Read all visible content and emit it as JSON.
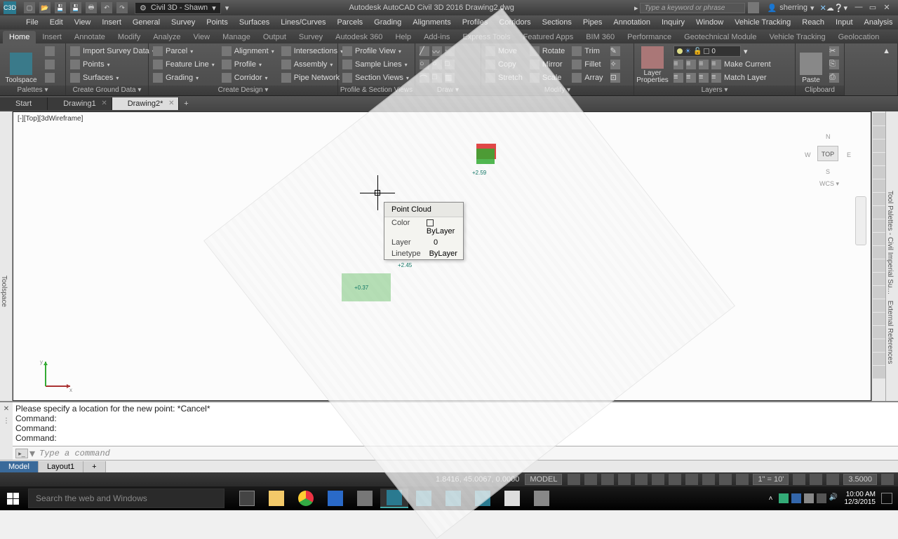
{
  "title": "Autodesk AutoCAD Civil 3D 2016   Drawing2.dwg",
  "workspace": "Civil 3D - Shawn",
  "search_placeholder": "Type a keyword or phrase",
  "user": "sherring",
  "menu": [
    "File",
    "Edit",
    "View",
    "Insert",
    "General",
    "Survey",
    "Points",
    "Surfaces",
    "Lines/Curves",
    "Parcels",
    "Grading",
    "Alignments",
    "Profiles",
    "Corridors",
    "Sections",
    "Pipes",
    "Annotation",
    "Inquiry",
    "Window",
    "Vehicle Tracking",
    "Reach",
    "Input",
    "Analysis"
  ],
  "ribbon_tabs": [
    "Home",
    "Insert",
    "Annotate",
    "Modify",
    "Analyze",
    "View",
    "Manage",
    "Output",
    "Survey",
    "Autodesk 360",
    "Help",
    "Add-ins",
    "Express Tools",
    "Featured Apps",
    "BIM 360",
    "Performance",
    "Geotechnical Module",
    "Vehicle Tracking",
    "Geolocation"
  ],
  "ribbon_active": "Home",
  "panel": {
    "palettes": {
      "title": "Palettes ▾",
      "big": "Toolspace"
    },
    "ground": {
      "title": "Create Ground Data ▾",
      "items": [
        "Import Survey Data",
        "Points",
        "Surfaces"
      ]
    },
    "design": {
      "title": "Create Design ▾",
      "col1": [
        "Parcel",
        "Feature Line",
        "Grading"
      ],
      "col2": [
        "Alignment",
        "Profile",
        "Corridor"
      ],
      "col3": [
        "Intersections",
        "Assembly",
        "Pipe Network"
      ]
    },
    "psv": {
      "title": "Profile & Section Views",
      "items": [
        "Profile View",
        "Sample Lines",
        "Section Views"
      ]
    },
    "draw": {
      "title": "Draw ▾"
    },
    "modify": {
      "title": "Modify ▾",
      "col1": [
        "Move",
        "Copy",
        "Stretch"
      ],
      "col2": [
        "Rotate",
        "Mirror",
        "Scale"
      ],
      "col3": [
        "Trim",
        "Fillet",
        "Array"
      ]
    },
    "layers": {
      "title": "Layers ▾",
      "big": "Layer Properties",
      "value": "0",
      "items": [
        "Make Current",
        "Match Layer"
      ]
    },
    "clipboard": {
      "title": "Clipboard",
      "big": "Paste"
    }
  },
  "doc_tabs": [
    "Start",
    "Drawing1",
    "Drawing2*"
  ],
  "doc_active": 2,
  "viewport_label": "[-][Top][3dWireframe]",
  "viewcube": {
    "face": "TOP",
    "wcs": "WCS ▾",
    "n": "N",
    "s": "S",
    "e": "E",
    "w": "W"
  },
  "tooltip": {
    "title": "Point Cloud",
    "rows": [
      {
        "k": "Color",
        "v": "ByLayer",
        "swatch": true
      },
      {
        "k": "Layer",
        "v": "0"
      },
      {
        "k": "Linetype",
        "v": "ByLayer"
      }
    ]
  },
  "cmd_history": [
    "Please specify a location for the new point: *Cancel*",
    "Command:",
    "Command:",
    "Command:"
  ],
  "cmd_placeholder": "Type a command",
  "layout_tabs": [
    "Model",
    "Layout1"
  ],
  "layout_active": 0,
  "status": {
    "coords": "1.8416, 45.0067, 0.0000",
    "space": "MODEL",
    "scale_annot": "1\" = 10'",
    "zoom": "3.5000"
  },
  "taskbar": {
    "search": "Search the web and Windows",
    "time": "10:00 AM",
    "date": "12/3/2015"
  }
}
